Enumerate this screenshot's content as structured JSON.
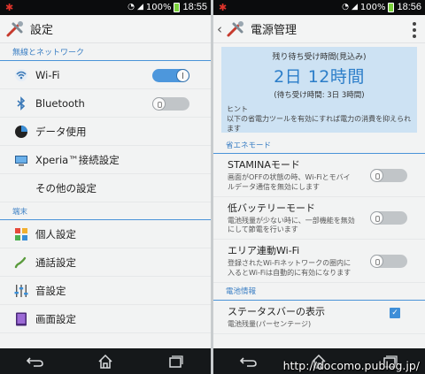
{
  "left": {
    "status": {
      "battery": "100%",
      "time": "18:55"
    },
    "title": "設定",
    "sections": [
      {
        "header": "無線とネットワーク",
        "items": [
          {
            "label": "Wi-Fi",
            "toggle": "on"
          },
          {
            "label": "Bluetooth",
            "toggle": "off"
          },
          {
            "label": "データ使用"
          },
          {
            "label": "Xperia™接続設定"
          },
          {
            "label": "その他の設定"
          }
        ]
      },
      {
        "header": "端末",
        "items": [
          {
            "label": "個人設定"
          },
          {
            "label": "通話設定"
          },
          {
            "label": "音設定"
          },
          {
            "label": "画面設定"
          }
        ]
      }
    ]
  },
  "right": {
    "status": {
      "battery": "100%",
      "time": "18:56"
    },
    "title": "電源管理",
    "banner": {
      "label": "残り待ち受け時間(見込み)",
      "value": "2日 12時間",
      "sub": "(待ち受け時間: 3日 3時間)",
      "hint_title": "ヒント",
      "hint_text": "以下の省電力ツールを有効にすれば電力の消費を抑えられます"
    },
    "section1": "省エネモード",
    "items": [
      {
        "title": "STAMINAモード",
        "desc": "画面がOFFの状態の時、Wi-Fiとモバイルデータ通信を無効にします",
        "toggle": "off"
      },
      {
        "title": "低バッテリーモード",
        "desc": "電池残量が少ない時に、一部機能を無効にして節電を行います",
        "toggle": "off"
      },
      {
        "title": "エリア連動Wi-Fi",
        "desc": "登録されたWi-Fiネットワークの圏内に入るとWi-Fiは自動的に有効になります",
        "toggle": "off"
      }
    ],
    "section2": "電池情報",
    "statusbar_item": {
      "title": "ステータスバーの表示",
      "desc": "電池残量(パーセンテージ)",
      "checked": true
    }
  },
  "watermark": "http://docomo.publog.jp/",
  "colors": {
    "accent": "#3b7fc4",
    "toggle_on": "#4d97dc",
    "banner": "#cde2f3"
  }
}
